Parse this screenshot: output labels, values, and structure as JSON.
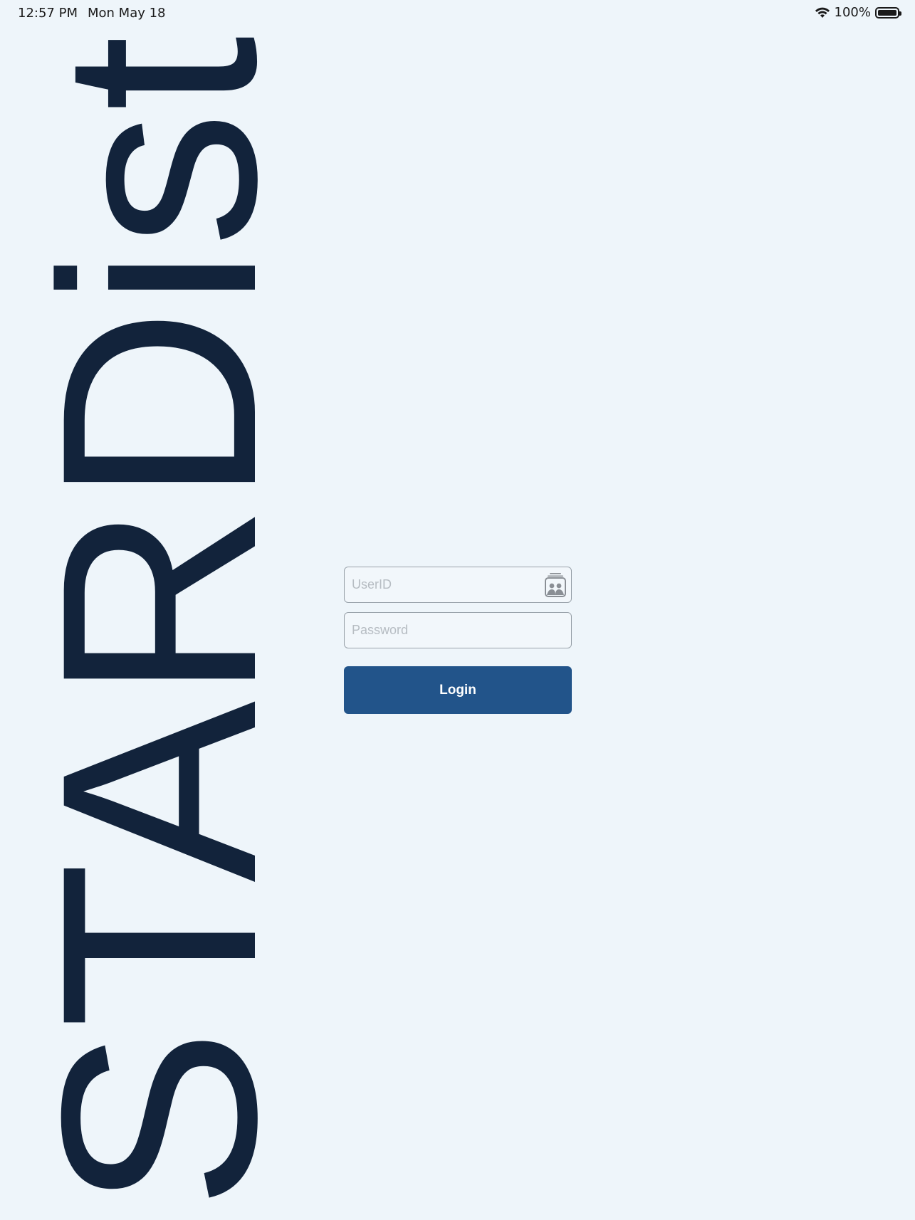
{
  "status_bar": {
    "time": "12:57 PM",
    "date": "Mon May 18",
    "battery": "100%",
    "battery_level": 1.0,
    "icons": [
      "wifi-icon",
      "battery-icon"
    ]
  },
  "logo": {
    "text": "STARDist",
    "color": "#12233b",
    "orientation": "vertical-bottom-to-top"
  },
  "login": {
    "userid_placeholder": "UserID",
    "userid_value": "",
    "password_placeholder": "Password",
    "password_value": "",
    "login_label": "Login",
    "button_color": "#22548a",
    "userid_icon": "contact-card-icon"
  },
  "colors": {
    "background": "#eef5fa",
    "accent": "#22548a",
    "logo": "#12233b"
  }
}
